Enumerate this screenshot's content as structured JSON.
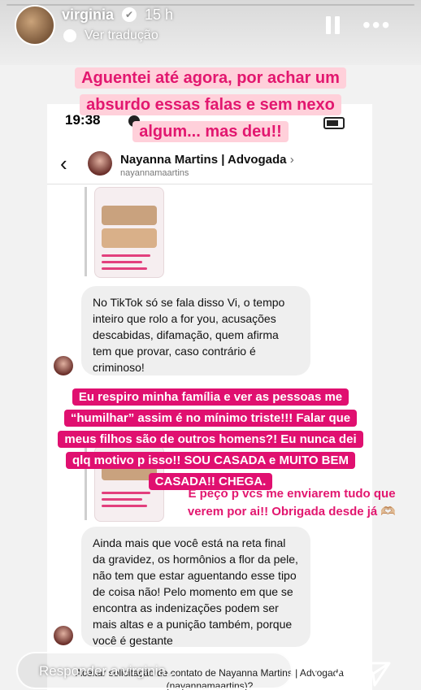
{
  "header": {
    "username": "virginia",
    "verified_symbol": "✔",
    "time_ago": "15 h",
    "translate_label": "Ver tradução"
  },
  "screenshot": {
    "clock": "19:38",
    "chat_name": "Nayanna Martins | Advogada",
    "chat_name_chevron": "›",
    "chat_handle": "nayannamaartins",
    "back_symbol": "‹",
    "message_1": "No TikTok só se fala disso Vi, o tempo inteiro que rolo a for you, acusações descabidas, difamação, quem afirma tem que provar, caso contrário é criminoso!",
    "message_2": "Ainda mais que você está na reta final da gravidez, os hormônios a flor da pele, não tem que estar aguentando esse tipo de coisa não! Pelo momento em que se encontra as indenizações podem ser mais altas e a punição também, porque você é gestante",
    "footer_question": "Aceitar solicitação de contato de Nayanna Martins | Advogada (nayannamaartins)?"
  },
  "captions": {
    "top_lines": [
      "Aguentei até agora, por achar um",
      "absurdo essas falas e sem nexo",
      "algum... mas deu!!"
    ],
    "middle_lines": [
      "Eu respiro minha família e ver as pessoas me",
      "“humilhar” assim é no mínimo triste!!! Falar que",
      "meus filhos são de outros homens?! Eu nunca dei",
      "qlq motivo p isso!! SOU CASADA e MUITO BEM",
      "CASADA!! CHEGA."
    ],
    "request_lines": [
      "E peço p vcs me enviarem tudo que",
      "verem por ai!! Obrigada desde já 🫶🏼"
    ]
  },
  "footer": {
    "reply_placeholder": "Responder a virginia..."
  },
  "colors": {
    "caption_pink": "#e2176f",
    "caption_light_bg": "#ffd0da",
    "caption_hot_bg": "#e01070"
  }
}
